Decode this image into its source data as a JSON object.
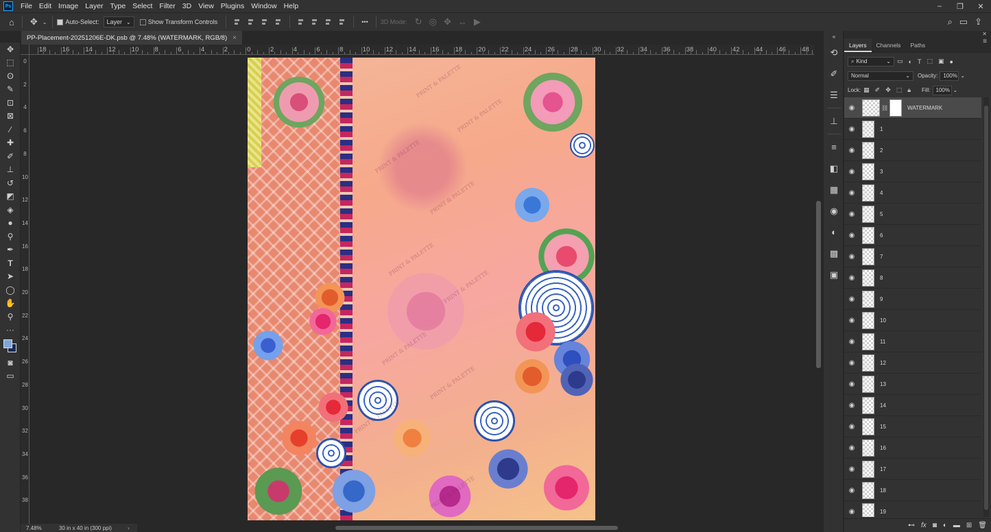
{
  "app": {
    "logo": "Ps"
  },
  "menu": [
    "File",
    "Edit",
    "Image",
    "Layer",
    "Type",
    "Select",
    "Filter",
    "3D",
    "View",
    "Plugins",
    "Window",
    "Help"
  ],
  "window_controls": {
    "minimize": "–",
    "restore": "❐",
    "close": "✕"
  },
  "options_bar": {
    "auto_select_label": "Auto-Select:",
    "auto_select_checked": true,
    "auto_select_target": "Layer",
    "show_transform_label": "Show Transform Controls",
    "show_transform_checked": false,
    "three_d_mode_label": "3D Mode:",
    "more_label": "•••"
  },
  "document": {
    "tab_title": "PP-Placement-20251206E-DK.psb @ 7.48% (WATERMARK, RGB/8)",
    "close_glyph": "×",
    "watermark_text": "PRINT & PALETTE"
  },
  "ruler_top": [
    "18",
    "16",
    "14",
    "12",
    "10",
    "8",
    "6",
    "4",
    "2",
    "0",
    "2",
    "4",
    "6",
    "8",
    "10",
    "12",
    "14",
    "16",
    "18",
    "20",
    "22",
    "24",
    "26",
    "28",
    "30",
    "32",
    "34",
    "36",
    "38",
    "40",
    "42",
    "44",
    "46",
    "48"
  ],
  "ruler_left": [
    "0",
    "2",
    "4",
    "6",
    "8",
    "10",
    "12",
    "14",
    "16",
    "18",
    "20",
    "22",
    "24",
    "26",
    "28",
    "30",
    "32",
    "34",
    "36",
    "38"
  ],
  "status": {
    "zoom": "7.48%",
    "doc_info": "30 in x 40 in (300 ppi)",
    "arrow": "›"
  },
  "layers_panel": {
    "tabs": [
      "Layers",
      "Channels",
      "Paths"
    ],
    "active_tab": "Layers",
    "filter_kind": "Kind",
    "blend_mode": "Normal",
    "opacity_label": "Opacity:",
    "opacity_value": "100%",
    "lock_label": "Lock:",
    "fill_label": "Fill:",
    "fill_value": "100%",
    "layers": [
      {
        "name": "WATERMARK",
        "selected": true,
        "has_mask": true
      },
      {
        "name": "1"
      },
      {
        "name": "2"
      },
      {
        "name": "3"
      },
      {
        "name": "4"
      },
      {
        "name": "5"
      },
      {
        "name": "6"
      },
      {
        "name": "7"
      },
      {
        "name": "8"
      },
      {
        "name": "9"
      },
      {
        "name": "10"
      },
      {
        "name": "11"
      },
      {
        "name": "12"
      },
      {
        "name": "13"
      },
      {
        "name": "14"
      },
      {
        "name": "15"
      },
      {
        "name": "16"
      },
      {
        "name": "17"
      },
      {
        "name": "18"
      },
      {
        "name": "19"
      }
    ]
  }
}
